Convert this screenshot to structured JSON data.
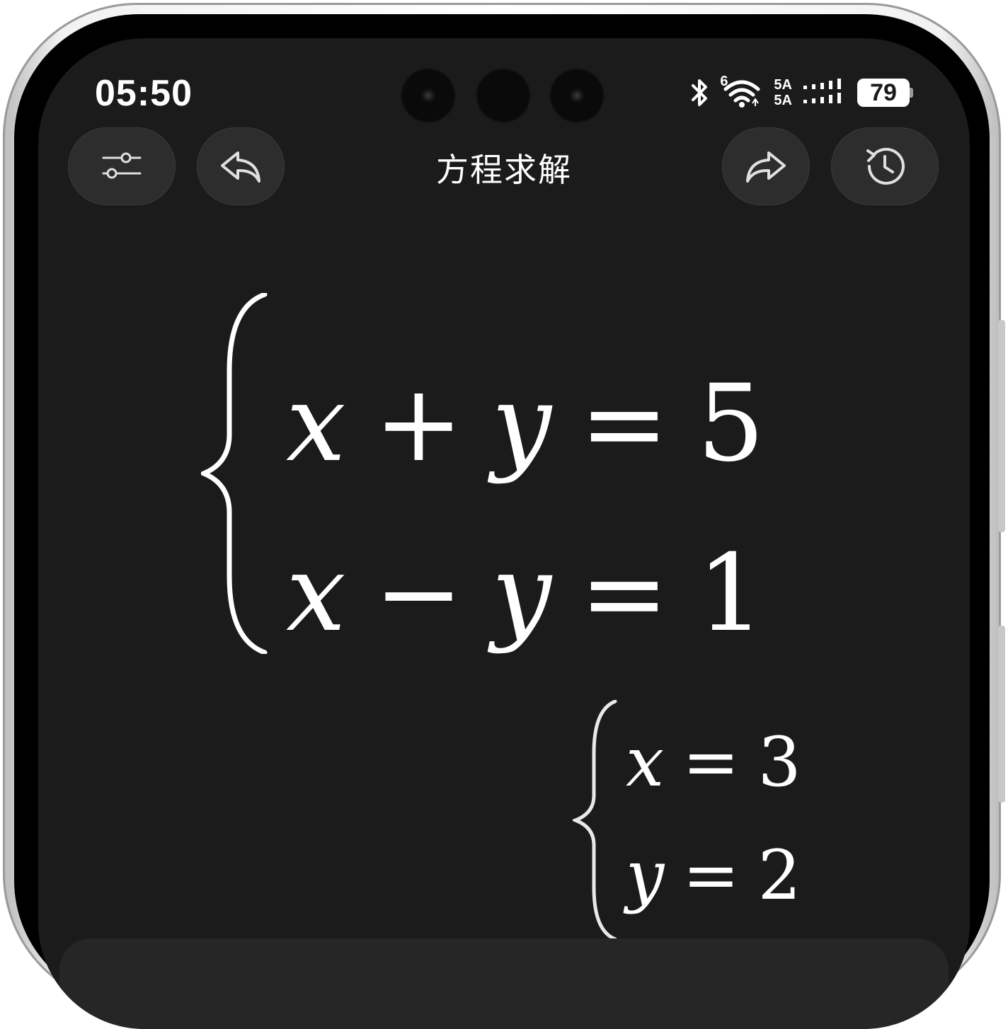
{
  "status_bar": {
    "time": "05:50",
    "wifi_tag": "6",
    "net_top": "5A",
    "net_bottom": "5A",
    "battery": "79"
  },
  "header": {
    "title": "方程求解",
    "icons": [
      "settings-sliders-icon",
      "undo-icon",
      "redo-icon",
      "history-icon"
    ]
  },
  "equation_system": {
    "rows": [
      {
        "lhs_a": "x",
        "op": "+",
        "lhs_b": "y",
        "eq": "=",
        "rhs": "5"
      },
      {
        "lhs_a": "x",
        "op": "−",
        "lhs_b": "y",
        "eq": "=",
        "rhs": "1"
      }
    ]
  },
  "solution": {
    "rows": [
      {
        "var": "x",
        "eq": "=",
        "value": "3"
      },
      {
        "var": "y",
        "eq": "=",
        "value": "2"
      }
    ]
  },
  "colors": {
    "background": "#1b1b1b",
    "button": "#2d2d2d",
    "text": "#ffffff"
  }
}
